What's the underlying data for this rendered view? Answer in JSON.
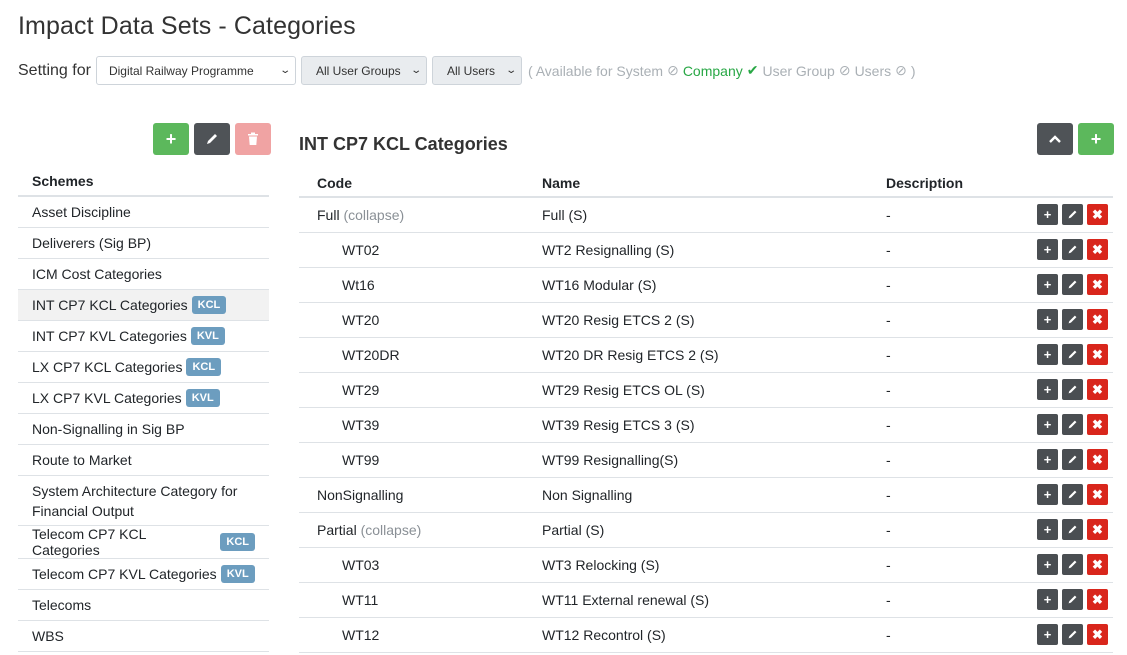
{
  "page": {
    "title": "Impact Data Sets - Categories"
  },
  "setting": {
    "label": "Setting for",
    "company": "Digital Railway Programme",
    "user_groups": "All User Groups",
    "users": "All Users",
    "availability": {
      "prefix": "( Available for System",
      "company": "Company",
      "user_group": "User Group",
      "users": "Users",
      "suffix": ")"
    }
  },
  "schemes": {
    "header": "Schemes",
    "items": [
      {
        "label": "Asset Discipline",
        "badge": ""
      },
      {
        "label": "Deliverers (Sig BP)",
        "badge": ""
      },
      {
        "label": "ICM Cost Categories",
        "badge": ""
      },
      {
        "label": "INT CP7 KCL Categories",
        "badge": "KCL"
      },
      {
        "label": "INT CP7 KVL Categories",
        "badge": "KVL"
      },
      {
        "label": "LX CP7 KCL Categories",
        "badge": "KCL"
      },
      {
        "label": "LX CP7 KVL Categories",
        "badge": "KVL"
      },
      {
        "label": "Non-Signalling in Sig BP",
        "badge": ""
      },
      {
        "label": "Route to Market",
        "badge": ""
      },
      {
        "label": "System Architecture Category for Financial Output",
        "badge": ""
      },
      {
        "label": "Telecom CP7 KCL Categories",
        "badge": "KCL"
      },
      {
        "label": "Telecom CP7 KVL Categories",
        "badge": "KVL"
      },
      {
        "label": "Telecoms",
        "badge": ""
      },
      {
        "label": "WBS",
        "badge": ""
      }
    ]
  },
  "categories": {
    "title": "INT CP7 KCL Categories",
    "columns": {
      "code": "Code",
      "name": "Name",
      "description": "Description"
    },
    "collapse_label": "(collapse)",
    "rows": [
      {
        "code": "Full",
        "name": "Full (S)",
        "description": "-",
        "level": 0,
        "collapsible": true
      },
      {
        "code": "WT02",
        "name": "WT2 Resignalling (S)",
        "description": "-",
        "level": 1,
        "collapsible": false
      },
      {
        "code": "Wt16",
        "name": "WT16 Modular (S)",
        "description": "-",
        "level": 1,
        "collapsible": false
      },
      {
        "code": "WT20",
        "name": "WT20 Resig ETCS 2 (S)",
        "description": "-",
        "level": 1,
        "collapsible": false
      },
      {
        "code": "WT20DR",
        "name": "WT20 DR Resig ETCS 2 (S)",
        "description": "-",
        "level": 1,
        "collapsible": false
      },
      {
        "code": "WT29",
        "name": "WT29 Resig ETCS OL (S)",
        "description": "-",
        "level": 1,
        "collapsible": false
      },
      {
        "code": "WT39",
        "name": "WT39 Resig ETCS 3 (S)",
        "description": "-",
        "level": 1,
        "collapsible": false
      },
      {
        "code": "WT99",
        "name": "WT99 Resignalling(S)",
        "description": "-",
        "level": 1,
        "collapsible": false
      },
      {
        "code": "NonSignalling",
        "name": "Non Signalling",
        "description": "-",
        "level": 0,
        "collapsible": false
      },
      {
        "code": "Partial",
        "name": "Partial (S)",
        "description": "-",
        "level": 0,
        "collapsible": true
      },
      {
        "code": "WT03",
        "name": "WT3 Relocking (S)",
        "description": "-",
        "level": 1,
        "collapsible": false
      },
      {
        "code": "WT11",
        "name": "WT11 External renewal (S)",
        "description": "-",
        "level": 1,
        "collapsible": false
      },
      {
        "code": "WT12",
        "name": "WT12 Recontrol (S)",
        "description": "-",
        "level": 1,
        "collapsible": false
      }
    ]
  },
  "colors": {
    "green": "#5cb85c",
    "dark": "#4f5357",
    "red": "#d9261c",
    "badge": "#6c9dbf"
  }
}
